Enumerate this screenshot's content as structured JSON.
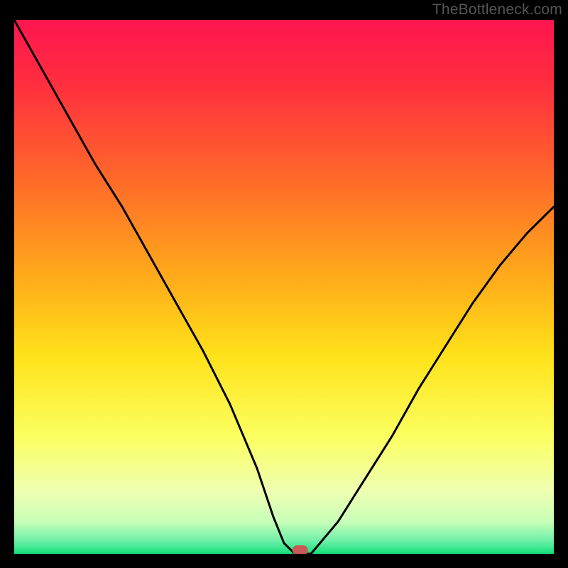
{
  "watermark": "TheBottleneck.com",
  "chart_data": {
    "type": "line",
    "title": "",
    "xlabel": "",
    "ylabel": "",
    "xlim": [
      0,
      100
    ],
    "ylim": [
      0,
      100
    ],
    "optimum_x": 53,
    "x": [
      0,
      5,
      10,
      15,
      20,
      25,
      30,
      35,
      40,
      45,
      48,
      50,
      52,
      55,
      60,
      65,
      70,
      75,
      80,
      85,
      90,
      95,
      100
    ],
    "y": [
      100,
      91,
      82,
      73,
      65,
      56,
      47,
      38,
      28,
      16,
      7,
      2,
      0,
      0,
      6,
      14,
      22,
      31,
      39,
      47,
      54,
      60,
      65
    ],
    "gradient_stops": [
      {
        "offset": 0.0,
        "color": "#ff1650"
      },
      {
        "offset": 0.12,
        "color": "#ff2e3f"
      },
      {
        "offset": 0.3,
        "color": "#ff6a29"
      },
      {
        "offset": 0.48,
        "color": "#ffaa1a"
      },
      {
        "offset": 0.63,
        "color": "#ffe21a"
      },
      {
        "offset": 0.78,
        "color": "#fbff60"
      },
      {
        "offset": 0.88,
        "color": "#f0ffb0"
      },
      {
        "offset": 0.94,
        "color": "#c8ffb8"
      },
      {
        "offset": 0.975,
        "color": "#70f0a8"
      },
      {
        "offset": 1.0,
        "color": "#14e07a"
      }
    ],
    "marker": {
      "color": "#c75b57",
      "rx": 11,
      "ry": 7
    }
  }
}
